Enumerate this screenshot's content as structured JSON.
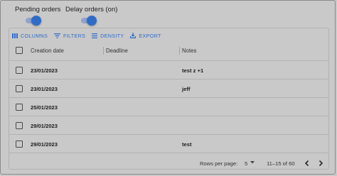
{
  "toggles": [
    {
      "label": "Pending orders",
      "on": true
    },
    {
      "label": "Delay orders (on)",
      "on": true
    }
  ],
  "toolbar": {
    "columns": "COLUMNS",
    "filters": "FILTERS",
    "density": "DENSITY",
    "export": "EXPORT"
  },
  "colors": {
    "accent": "#2f6cc8",
    "background": "#c9c9c9",
    "divider": "#b2b2b2"
  },
  "table": {
    "headers": {
      "creation_date": "Creation date",
      "deadline": "Deadline",
      "notes": "Notes"
    },
    "rows": [
      {
        "creation_date": "23/01/2023",
        "deadline": "",
        "notes": "test z +1"
      },
      {
        "creation_date": "23/01/2023",
        "deadline": "",
        "notes": "jeff"
      },
      {
        "creation_date": "25/01/2023",
        "deadline": "",
        "notes": ""
      },
      {
        "creation_date": "29/01/2023",
        "deadline": "",
        "notes": ""
      },
      {
        "creation_date": "29/01/2023",
        "deadline": "",
        "notes": "test"
      }
    ]
  },
  "pagination": {
    "rows_per_page_label": "Rows per page:",
    "rows_per_page_value": "5",
    "range": "11–15 of 60"
  },
  "icons": [
    "columns-icon",
    "filter-icon",
    "density-icon",
    "export-icon",
    "caret-down-icon",
    "chevron-left-icon",
    "chevron-right-icon"
  ]
}
